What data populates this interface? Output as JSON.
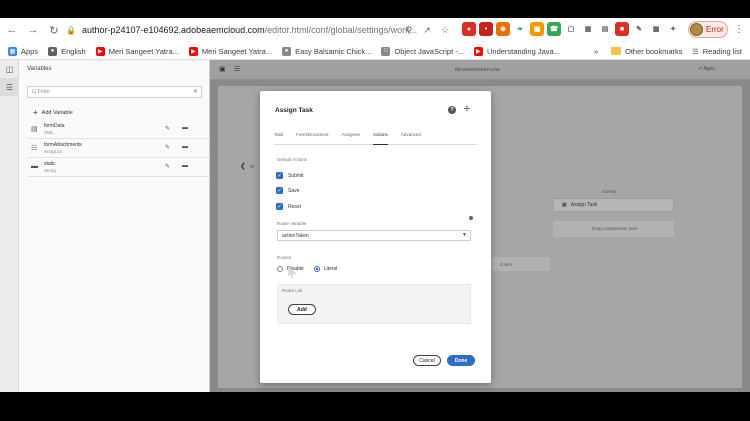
{
  "browser": {
    "url_host": "author-p24107-e104692.adobeaemcloud.com",
    "url_path": "/editor.html/conf/global/settings/work...",
    "profile_label": "Error",
    "bookmarks": [
      {
        "label": "Apps",
        "icon": "apps-grid-icon",
        "color": "#4285f4"
      },
      {
        "label": "English",
        "icon": "globe-icon",
        "color": "#5f6368"
      },
      {
        "label": "Meri Sangeet Yatra...",
        "icon": "youtube-icon",
        "color": "#ff0000"
      },
      {
        "label": "Meri Sangeet Yatra...",
        "icon": "youtube-icon",
        "color": "#ff0000"
      },
      {
        "label": "Easy Balsamic Chick...",
        "icon": "recipe-icon",
        "color": "#888888"
      },
      {
        "label": "Object JavaScript -...",
        "icon": "page-icon",
        "color": "#888888"
      },
      {
        "label": "Understanding Java...",
        "icon": "youtube-icon",
        "color": "#ff0000"
      }
    ],
    "other_bookmarks": "Other bookmarks",
    "reading_list": "Reading list"
  },
  "sidebar": {
    "title": "Variables",
    "filter_placeholder": "Q Filter",
    "add_variable": "Add Variable",
    "variables": [
      {
        "name": "formData",
        "type": "XML",
        "icon": "document-icon"
      },
      {
        "name": "formAttachments",
        "type": "ArrayList",
        "icon": "list-icon"
      },
      {
        "name": "static",
        "type": "String",
        "icon": "text-icon"
      }
    ]
  },
  "editor": {
    "title": "REVIEWWORKFLOW",
    "app_label": "Apps",
    "ghost_activity": "Activity",
    "ghost_assign_task": "Assign Task",
    "ghost_drop": "Drag components here",
    "ghost_text": "it item",
    "ghost_left": "W"
  },
  "modal": {
    "title": "Assign Task",
    "tabs": [
      "Task",
      "Form/Document",
      "Assignee",
      "Actions",
      "Advanced"
    ],
    "active_tab": "Actions",
    "default_actions_label": "Default Actions",
    "actions": [
      "Submit",
      "Save",
      "Reset"
    ],
    "route_variable_label": "Route Variable",
    "route_variable_value": "actionTaken",
    "routes_label": "Routes",
    "route_options": [
      "Disable",
      "Literal"
    ],
    "route_selected": "Literal",
    "route_list_label": "Route List",
    "add_label": "Add",
    "cancel_label": "Cancel",
    "done_label": "Done"
  },
  "colors": {
    "accent": "#2d6fc6",
    "overlay": "#8a8a8a"
  }
}
